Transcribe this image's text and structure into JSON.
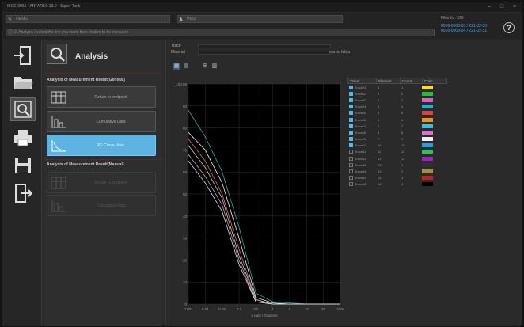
{
  "window": {
    "title": "IBCE-0966 / ANTARES 33.0 · Super Tank"
  },
  "infobar": {
    "field1": "OEMG",
    "field2": "HMS",
    "hint": "2. Analysis / select the line you want, then finalize to be executed",
    "id_label": "Fileinfo : 999",
    "id_values": [
      "0016-0003-03 / 221-02-30",
      "0016-0003-04 / 221-02-31"
    ],
    "help": "?"
  },
  "sidebar": [
    "import-icon",
    "open-folder-icon",
    "analysis-icon",
    "print-icon",
    "save-icon",
    "exit-icon"
  ],
  "panel": {
    "title": "Analysis",
    "section1": "Analysis of Measurement Result(General)",
    "section2": "Analysis of Measurement Result(Manual)",
    "buttons": [
      "Return to endpoint",
      "Cumulative Data",
      "PF Curve View"
    ],
    "disabled_buttons": [
      "Return to endpoint",
      "Cumulative Data"
    ]
  },
  "main": {
    "label1": "Trace",
    "label2": "Material",
    "value": "ma nd lab u",
    "chart_ylabel_top": "100.00"
  },
  "table": {
    "headers": [
      "Trace",
      "Element",
      "Count",
      "Color"
    ],
    "rows": [
      {
        "name": "Trace01",
        "el": "1",
        "count": "1",
        "color": "#f0e020",
        "on": true
      },
      {
        "name": "Trace02",
        "el": "2",
        "count": "2",
        "color": "#20c040",
        "on": true
      },
      {
        "name": "Trace03",
        "el": "3",
        "count": "3",
        "color": "#e060c0",
        "on": true
      },
      {
        "name": "Trace04",
        "el": "4",
        "count": "4",
        "color": "#20b0d0",
        "on": true
      },
      {
        "name": "Trace05",
        "el": "5",
        "count": "5",
        "color": "#e04040",
        "on": true
      },
      {
        "name": "Trace06",
        "el": "6",
        "count": "6",
        "color": "#f09020",
        "on": true
      },
      {
        "name": "Trace07",
        "el": "7",
        "count": "7",
        "color": "#30c0e0",
        "on": true
      },
      {
        "name": "Trace08",
        "el": "8",
        "count": "8",
        "color": "#e070d0",
        "on": true
      },
      {
        "name": "Trace09",
        "el": "9",
        "count": "9",
        "color": "#f0f0f0",
        "on": true
      },
      {
        "name": "Trace10",
        "el": "10",
        "count": "10",
        "color": "#20a0e0",
        "on": true
      },
      {
        "name": "Trace11",
        "el": "11",
        "count": "11",
        "color": "#30c060",
        "on": false
      },
      {
        "name": "Trace12",
        "el": "12",
        "count": "12",
        "color": "#a020c0",
        "on": false
      },
      {
        "name": "Trace13",
        "el": "13",
        "count": "1",
        "color": "#303030",
        "on": false
      },
      {
        "name": "Trace14",
        "el": "14",
        "count": "2",
        "color": "#a09040",
        "on": false
      },
      {
        "name": "Trace15",
        "el": "15",
        "count": "3",
        "color": "#c02020",
        "on": false
      },
      {
        "name": "Trace16",
        "el": "16",
        "count": "4",
        "color": "#000000",
        "on": false
      }
    ]
  },
  "chart_data": {
    "type": "line",
    "xticks": [
      "0.001",
      "0.01",
      "0.05",
      "0.1",
      "0.5",
      "1",
      "5",
      "10",
      "50",
      "1000"
    ],
    "yticks": [
      "100.00",
      "90",
      "80",
      "70",
      "60",
      "50",
      "40",
      "30",
      "20",
      "10",
      "0"
    ],
    "xlabel": "x ratio / Gradient",
    "ylim": [
      0,
      100
    ],
    "series": [
      {
        "color": "#20b0a0",
        "values": [
          88,
          76,
          60,
          35,
          5,
          1,
          0.5,
          0,
          0,
          0
        ]
      },
      {
        "color": "#f0f0f0",
        "values": [
          78,
          70,
          55,
          30,
          3,
          0.5,
          0,
          0,
          0,
          0
        ]
      },
      {
        "color": "#e07070",
        "values": [
          75,
          65,
          50,
          25,
          2,
          0,
          0,
          0,
          0,
          0
        ]
      },
      {
        "color": "#d0d0d0",
        "values": [
          72,
          62,
          48,
          22,
          2,
          0,
          0,
          0,
          0,
          0
        ]
      },
      {
        "color": "#c0a0c0",
        "values": [
          68,
          58,
          45,
          20,
          1,
          0,
          0,
          0,
          0,
          0
        ]
      },
      {
        "color": "#e0e0e0",
        "values": [
          65,
          55,
          42,
          18,
          1,
          0,
          0,
          0,
          0,
          0
        ]
      }
    ]
  }
}
